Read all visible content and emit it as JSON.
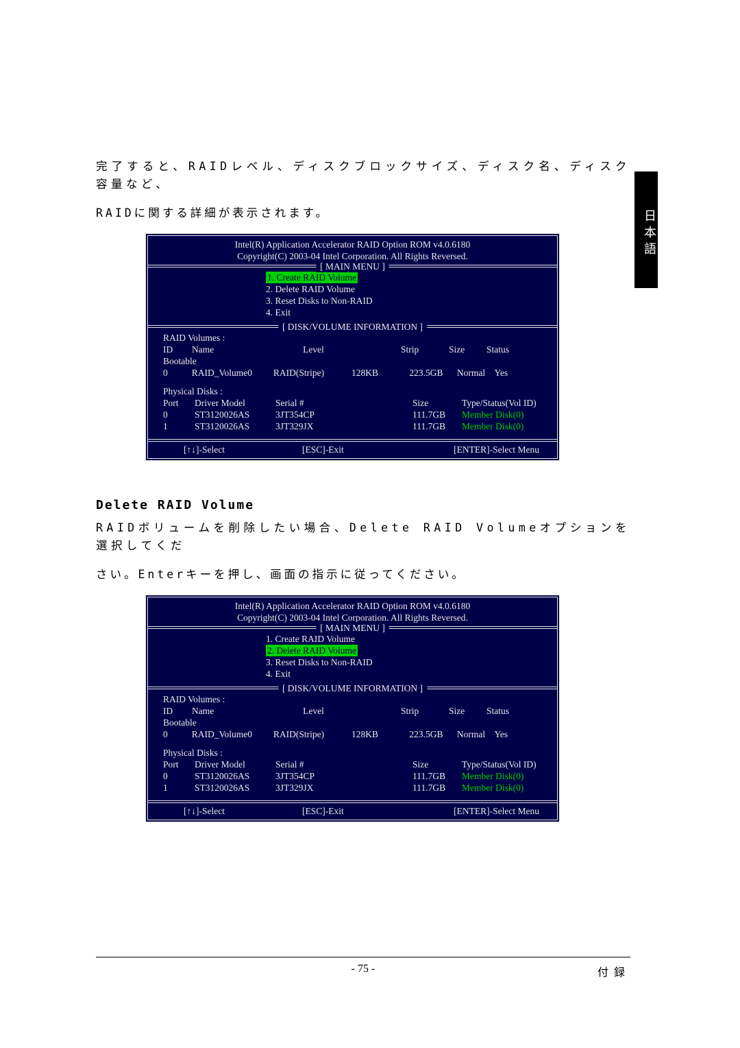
{
  "sideTab": "日本語",
  "intro1": "完了すると、RAIDレベル、ディスクブロックサイズ、ディスク名、ディスク容量など、",
  "intro2": "RAIDに関する詳細が表示されます。",
  "sectionTitle": "Delete RAID Volume",
  "deletePara1": "RAIDボリュームを削除したい場合、Delete RAID Volumeオプションを選択してくだ",
  "deletePara2": "さい。Enterキーを押し、画面の指示に従ってください。",
  "bios": {
    "title": "Intel(R) Application Accelerator RAID Option ROM v4.0.6180",
    "copy": "Copyright(C) 2003-04 Intel Corporation. All Rights Reversed.",
    "mainMenuLabel": "[ MAIN MENU ]",
    "menu": [
      "1. Create RAID Volume",
      "2. Delete RAID Volume",
      "3. Reset Disks to Non-RAID",
      "4. Exit"
    ],
    "diskInfoLabel": "[ DISK/VOLUME INFORMATION ]",
    "volHeader": "RAID Volumes :",
    "volCols": {
      "id": "ID",
      "name": "Name",
      "level": "Level",
      "strip": "Strip",
      "size": "Size",
      "status": "Status"
    },
    "bootable": "Bootable",
    "volRow": {
      "id": "0",
      "name": "RAID_Volume0",
      "level": "RAID(Stripe)",
      "strip": "128KB",
      "szVal": "223.5GB",
      "status": "Normal",
      "boot": "Yes"
    },
    "physHeader": "Physical Disks :",
    "physCols": {
      "port": "Port",
      "model": "Driver Model",
      "serial": "Serial #",
      "size": "Size",
      "type": "Type/Status(Vol ID)"
    },
    "physRows": [
      {
        "port": "0",
        "model": "ST3120026AS",
        "serial": "3JT354CP",
        "size": "111.7GB",
        "type": "Member Disk(0)"
      },
      {
        "port": "1",
        "model": "ST3120026AS",
        "serial": "3JT329JX",
        "size": "111.7GB",
        "type": "Member Disk(0)"
      }
    ],
    "footSelect": "[↑↓]-Select",
    "footExit": "[ESC]-Exit",
    "footEnter": "[ENTER]-Select Menu"
  },
  "pageNum": "- 75 -",
  "appendix": "付録"
}
